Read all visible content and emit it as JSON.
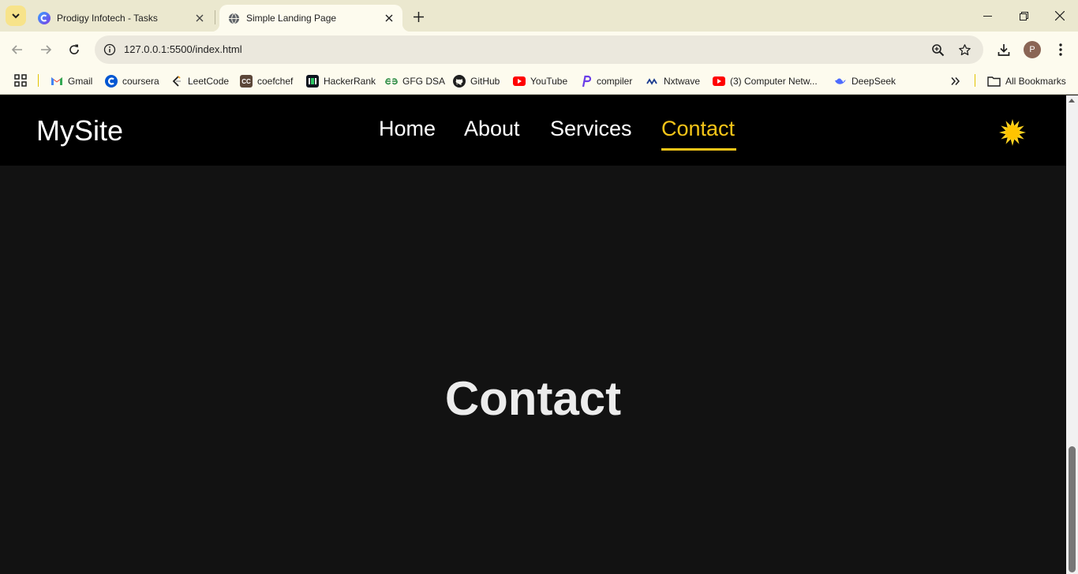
{
  "browser": {
    "tabs": [
      {
        "title": "Prodigy Infotech - Tasks",
        "favicon": "prodigy-icon",
        "active": false
      },
      {
        "title": "Simple Landing Page",
        "favicon": "globe-icon",
        "active": true
      }
    ],
    "address": {
      "url": "127.0.0.1:5500/index.html"
    },
    "profile_initial": "P",
    "bookmarks": [
      {
        "label": "Gmail",
        "icon": "gmail-icon"
      },
      {
        "label": "coursera",
        "icon": "coursera-icon"
      },
      {
        "label": "LeetCode",
        "icon": "leetcode-icon"
      },
      {
        "label": "coefchef",
        "icon": "codechef-icon"
      },
      {
        "label": "HackerRank",
        "icon": "hackerrank-icon"
      },
      {
        "label": "GFG DSA",
        "icon": "gfg-icon"
      },
      {
        "label": "GitHub",
        "icon": "github-icon"
      },
      {
        "label": "YouTube",
        "icon": "youtube-icon"
      },
      {
        "label": "compiler",
        "icon": "compiler-icon"
      },
      {
        "label": "Nxtwave",
        "icon": "nxtwave-icon"
      },
      {
        "label": "(3) Computer Netw...",
        "icon": "youtube-icon"
      },
      {
        "label": "DeepSeek",
        "icon": "deepseek-icon"
      }
    ],
    "all_bookmarks_label": "All Bookmarks"
  },
  "site": {
    "logo": "MySite",
    "nav": [
      {
        "label": "Home",
        "active": false
      },
      {
        "label": "About",
        "active": false
      },
      {
        "label": "Services",
        "active": false
      },
      {
        "label": "Contact",
        "active": true
      }
    ],
    "theme_toggle_icon": "sun-icon",
    "hero_title": "Contact",
    "colors": {
      "accent": "#f5c518",
      "nav_bg": "#000000",
      "page_bg": "#121212"
    }
  }
}
